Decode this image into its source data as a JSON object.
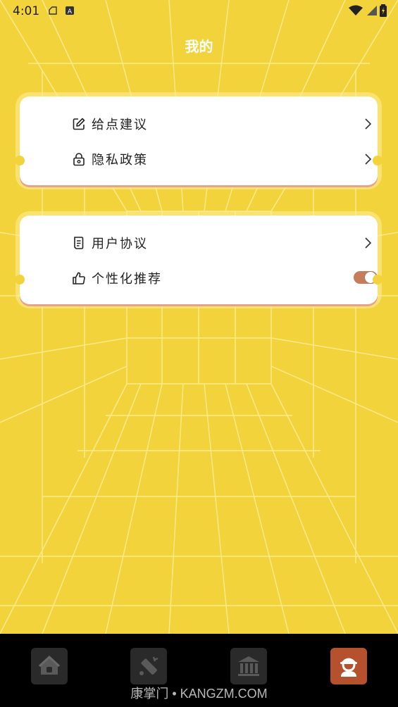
{
  "status_bar": {
    "time": "4:01",
    "left_icons": [
      "screenshot-icon",
      "app-notification-icon"
    ],
    "right_icons": [
      "wifi-icon",
      "signal-icon",
      "battery-charging-icon"
    ]
  },
  "header": {
    "title": "我的"
  },
  "settings_groups": [
    {
      "items": [
        {
          "label": "给点建议",
          "icon": "edit-icon",
          "action": "chevron"
        },
        {
          "label": "隐私政策",
          "icon": "lock-icon",
          "action": "chevron"
        }
      ]
    },
    {
      "items": [
        {
          "label": "用户协议",
          "icon": "document-icon",
          "action": "chevron"
        },
        {
          "label": "个性化推荐",
          "icon": "thumbs-up-icon",
          "action": "toggle",
          "toggle_on": true
        }
      ]
    }
  ],
  "bottom_nav": {
    "tabs": [
      {
        "icon": "home-icon",
        "active": false
      },
      {
        "icon": "tools-icon",
        "active": false
      },
      {
        "icon": "museum-icon",
        "active": false
      },
      {
        "icon": "profile-icon",
        "active": true
      }
    ]
  },
  "watermark": "康掌门 • KANGZM.COM",
  "colors": {
    "background": "#f2d33b",
    "accent": "#b5512c",
    "toggle": "#c67d5b"
  }
}
